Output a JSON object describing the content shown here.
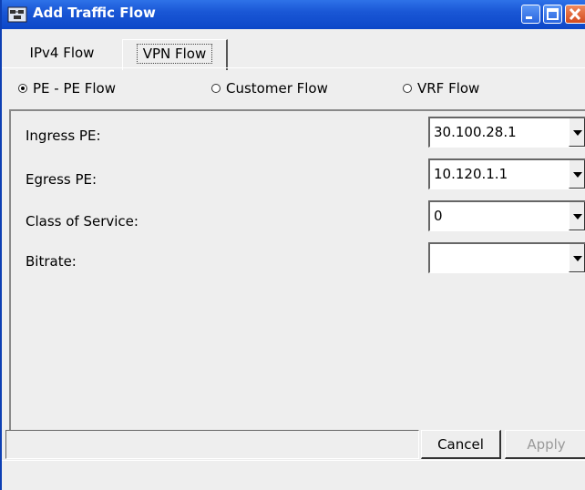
{
  "window": {
    "title": "Add Traffic Flow",
    "icons": [
      "app-icon",
      "minimize-icon",
      "maximize-icon",
      "close-icon"
    ]
  },
  "tabs": [
    {
      "label": "IPv4 Flow",
      "selected": false
    },
    {
      "label": "VPN Flow",
      "selected": true
    }
  ],
  "flow_types": [
    {
      "label": "PE - PE Flow",
      "selected": true
    },
    {
      "label": "Customer Flow",
      "selected": false
    },
    {
      "label": "VRF Flow",
      "selected": false
    }
  ],
  "form": {
    "ingress_pe": {
      "label": "Ingress PE:",
      "value": "30.100.28.1"
    },
    "egress_pe": {
      "label": "Egress PE:",
      "value": "10.120.1.1"
    },
    "class_of_service": {
      "label": "Class of Service:",
      "value": "0"
    },
    "bitrate": {
      "label": "Bitrate:",
      "value": ""
    }
  },
  "buttons": {
    "cancel": "Cancel",
    "apply": "Apply",
    "apply_enabled": false
  },
  "colors": {
    "titlebar": "#1a57d6",
    "close_button": "#d24a1e",
    "background": "#eeeeee",
    "disabled_text": "#9a9a9a"
  }
}
